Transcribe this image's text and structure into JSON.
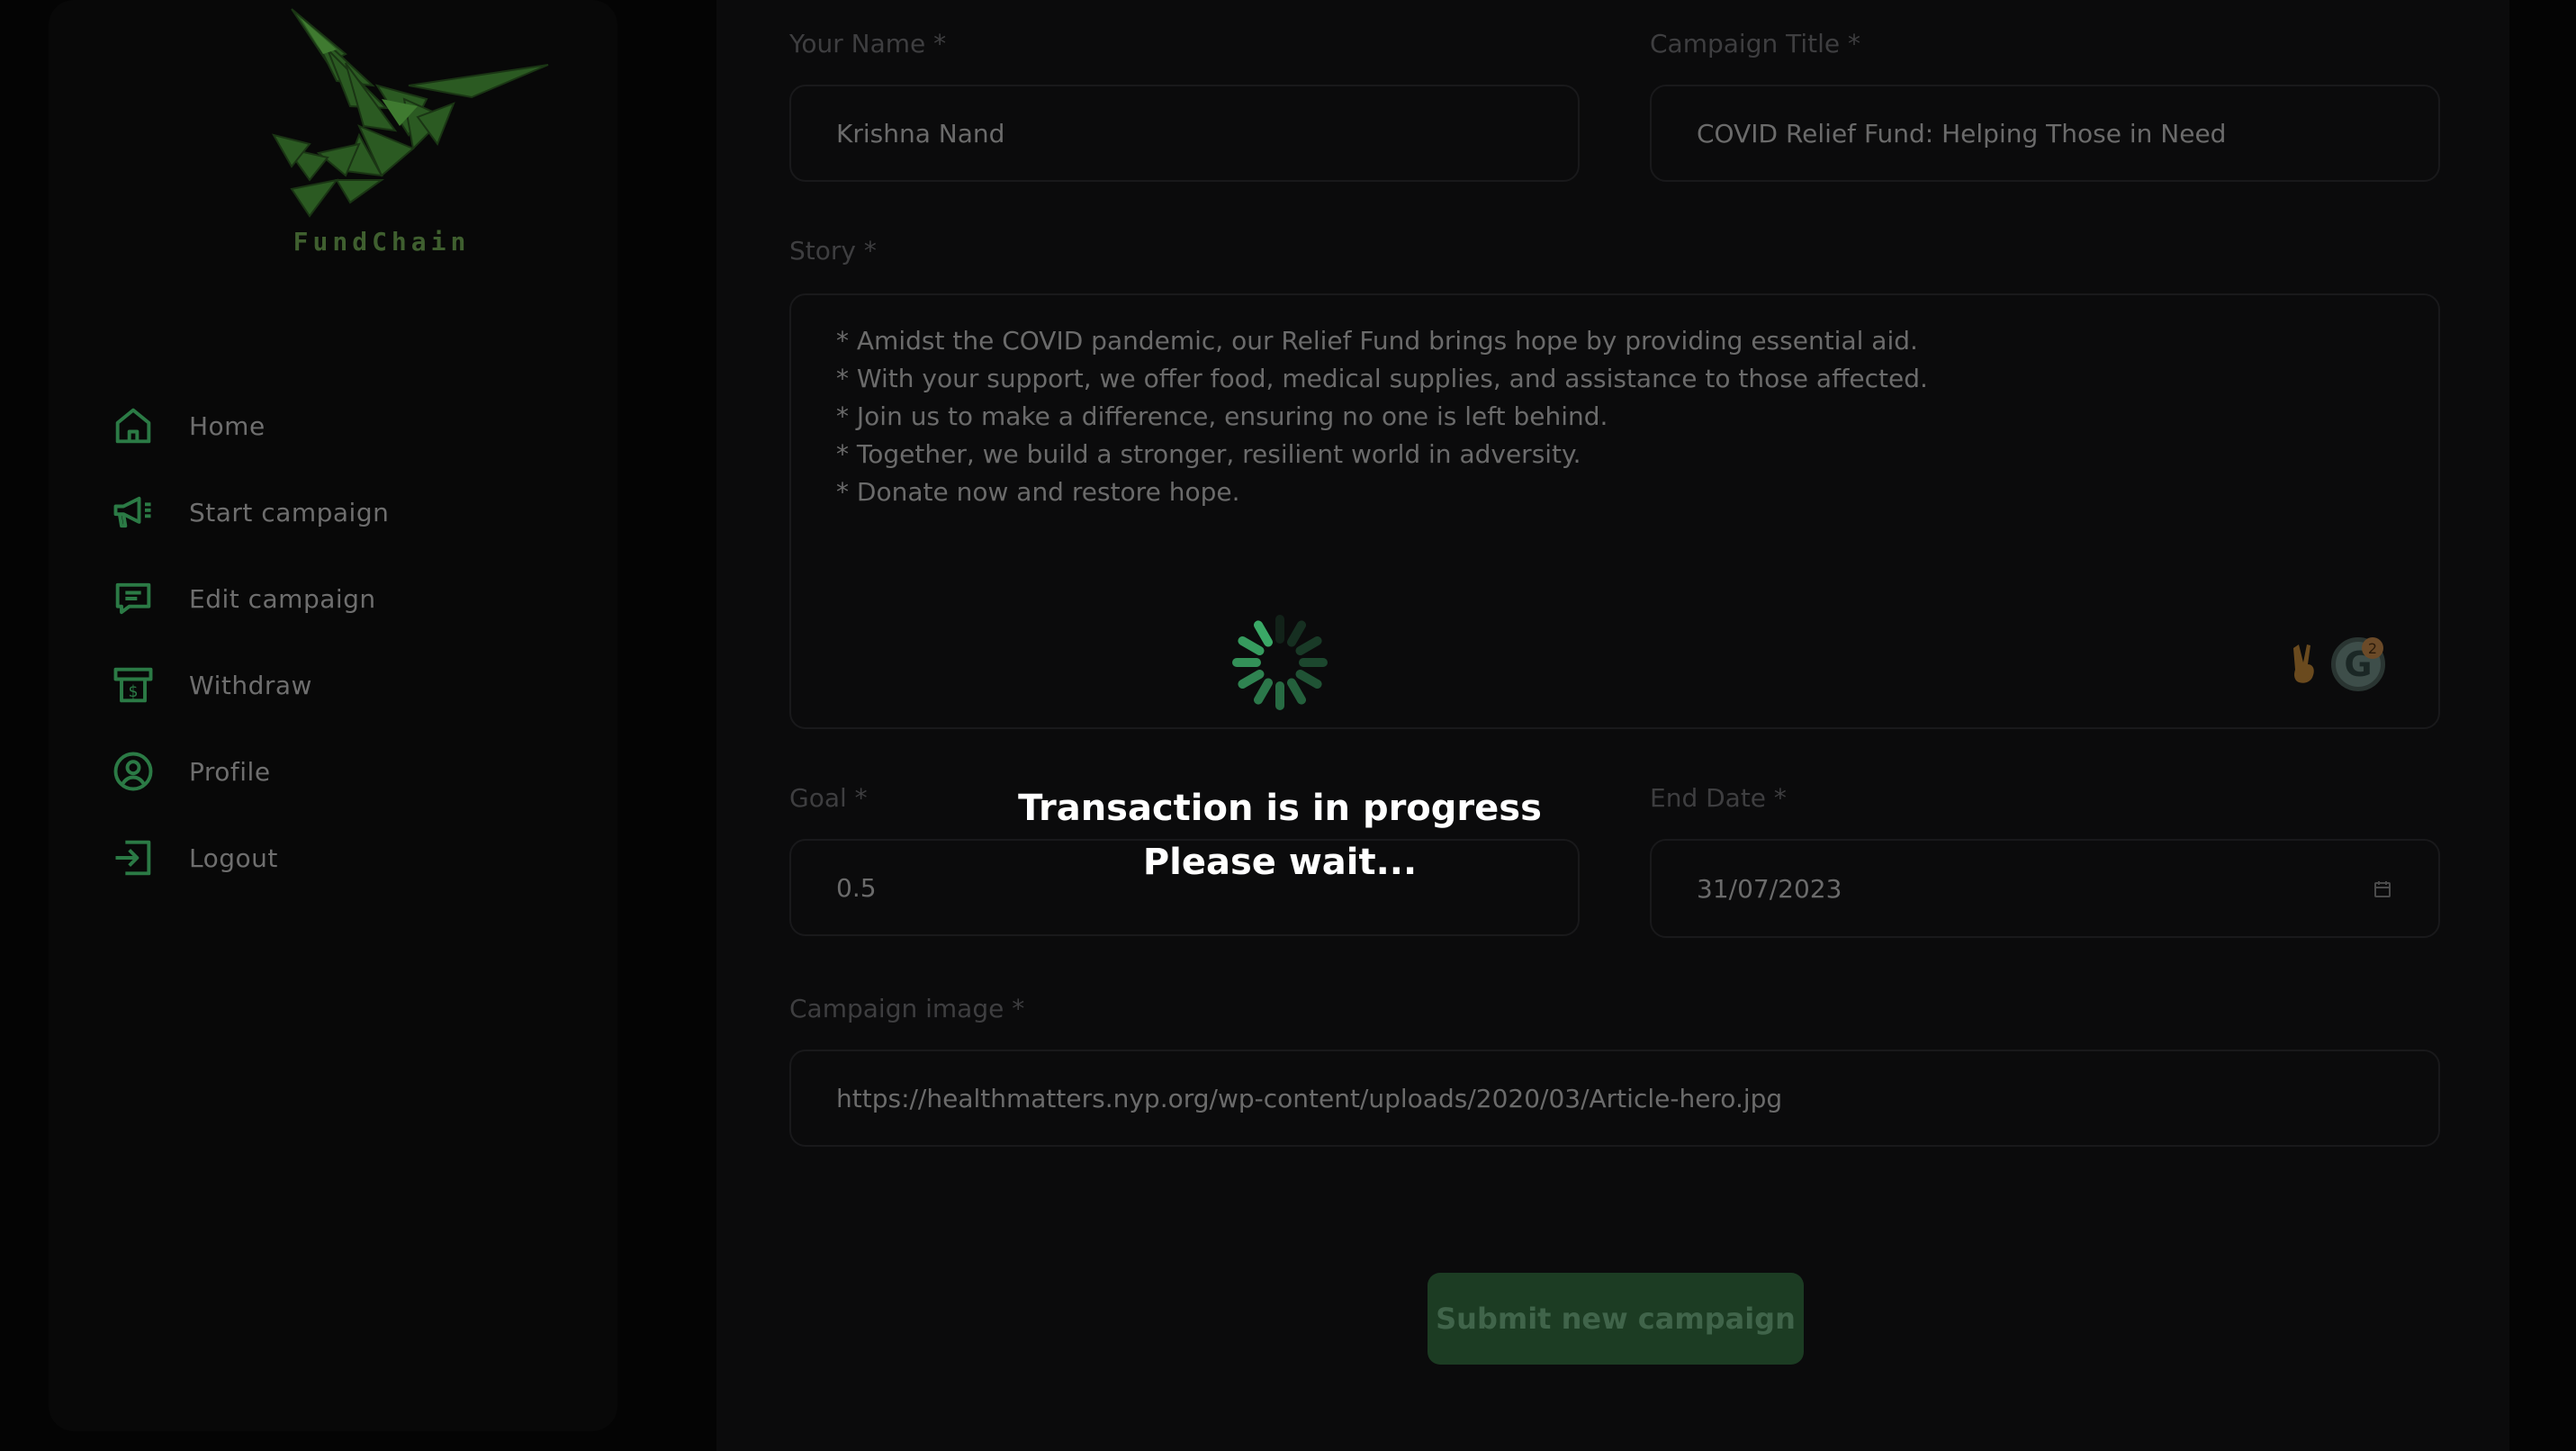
{
  "brand": {
    "name": "FundChain"
  },
  "sidebar": {
    "items": [
      {
        "label": "Home",
        "icon": "home-icon"
      },
      {
        "label": "Start campaign",
        "icon": "megaphone-icon"
      },
      {
        "label": "Edit campaign",
        "icon": "message-edit-icon"
      },
      {
        "label": "Withdraw",
        "icon": "dollar-withdraw-icon"
      },
      {
        "label": "Profile",
        "icon": "user-circle-icon"
      },
      {
        "label": "Logout",
        "icon": "logout-icon"
      }
    ]
  },
  "form": {
    "name": {
      "label": "Your Name *",
      "value": "Krishna Nand"
    },
    "title": {
      "label": "Campaign Title *",
      "value": "COVID Relief Fund: Helping Those in Need"
    },
    "story": {
      "label": "Story *",
      "lines": [
        "* Amidst the COVID pandemic, our Relief Fund brings hope by providing essential aid.",
        "* With your support, we offer food, medical supplies, and assistance to those affected.",
        "* Join us to make a difference, ensuring no one is left behind.",
        "* Together, we build a stronger, resilient world in adversity.",
        "* Donate now and restore hope."
      ]
    },
    "goal": {
      "label": "Goal *",
      "value": "0.5"
    },
    "end_date": {
      "label": "End Date *",
      "value": "31/07/2023"
    },
    "image": {
      "label": "Campaign image *",
      "value": "https://healthmatters.nyp.org/wp-content/uploads/2020/03/Article-hero.jpg"
    },
    "submit_label": "Submit new campaign"
  },
  "grammarly": {
    "letter": "G",
    "badge_count": "2"
  },
  "overlay": {
    "line1": "Transaction is in progress",
    "line2": "Please wait..."
  },
  "colors": {
    "accent": "#2f8a4f",
    "spinner": "#3aa866",
    "logo": "#2c5a24"
  }
}
